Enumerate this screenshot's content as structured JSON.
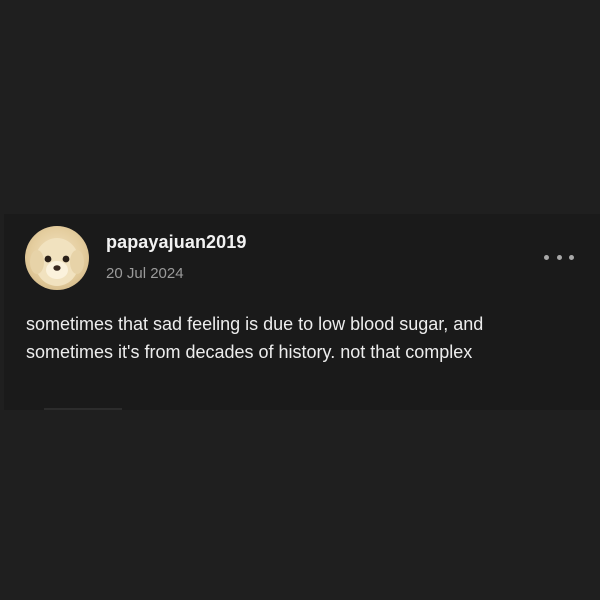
{
  "post": {
    "username": "papayajuan2019",
    "date": "20 Jul 2024",
    "avatar_icon": "puppy-avatar",
    "more_icon": "more-options-icon",
    "body_lines": [
      "sometimes that sad feeling is due to low blood sugar, and",
      "sometimes it's from decades of history. not that complex"
    ]
  },
  "colors": {
    "background": "#1f1f1f",
    "card": "#1a1a1a",
    "username": "#f2f2f2",
    "date": "#9b9b9b",
    "body_text": "#ededed"
  }
}
